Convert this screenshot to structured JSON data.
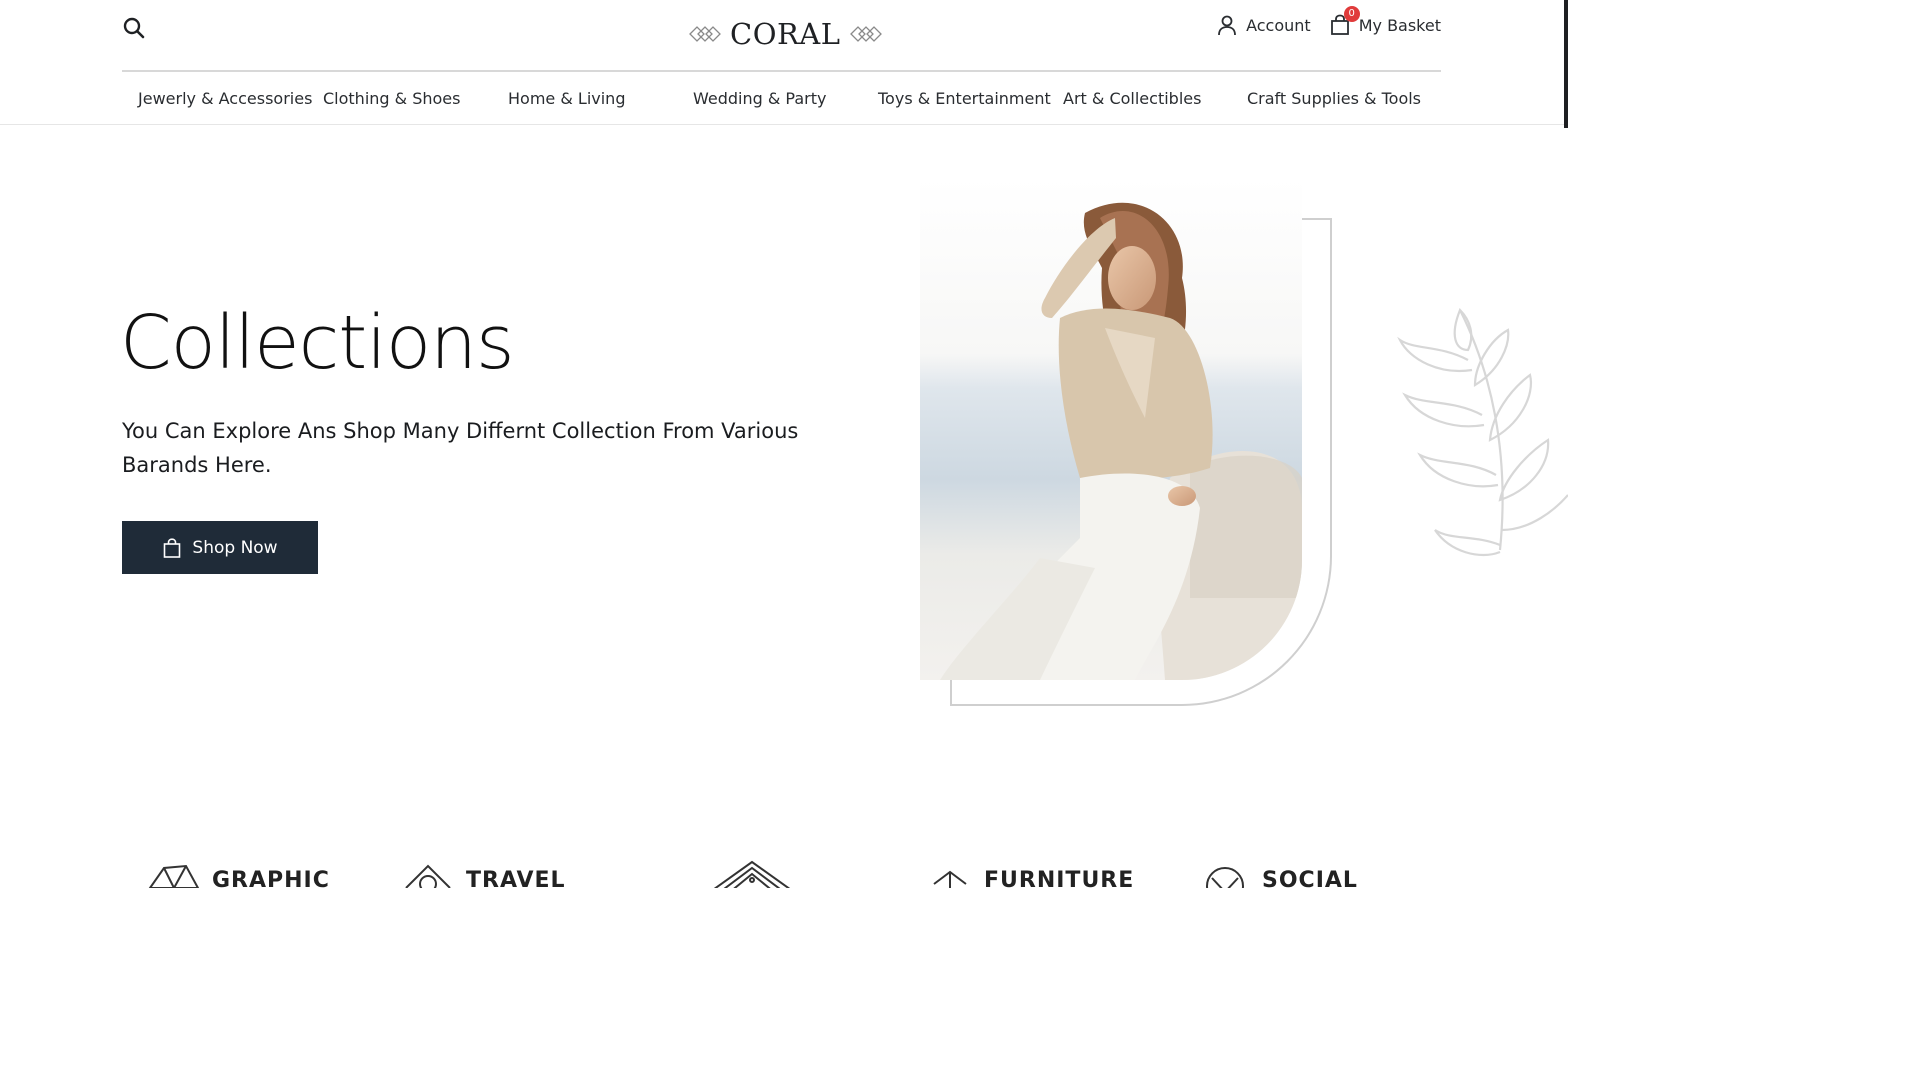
{
  "header": {
    "logo_text": "CORAL",
    "account_label": "Account",
    "basket_label": "My Basket",
    "basket_count": "0"
  },
  "nav": {
    "items": [
      "Jewerly & Accessories",
      "Clothing & Shoes",
      "Home & Living",
      "Wedding & Party",
      "Toys & Entertainment",
      "Art & Collectibles",
      "Craft Supplies & Tools"
    ]
  },
  "hero": {
    "title": "Collections",
    "subtitle": "You Can Explore Ans Shop Many Differnt Collection From Various Barands Here.",
    "button_label": "Shop Now",
    "image_alt": "Woman in beige blouse and white jeans leaning on a chair by the sea"
  },
  "brands": {
    "items": [
      "GRAPHIC",
      "TRAVEL",
      "",
      "FURNITURE",
      "SOCIAL"
    ]
  },
  "colors": {
    "button_bg": "#1f2b38",
    "badge": "#e03b3b",
    "text": "#1f2124"
  },
  "icons": [
    "search-icon",
    "logo-diamond-icon",
    "user-icon",
    "basket-icon",
    "shopping-bag-icon",
    "leaf-decoration-icon"
  ]
}
